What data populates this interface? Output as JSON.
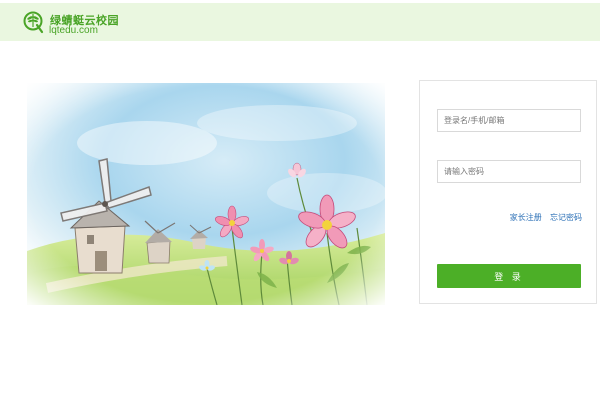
{
  "header": {
    "brand_name": "绿蜻蜓云校园",
    "brand_domain": "lqtedu.com",
    "background_color": "#eaf7e0",
    "brand_color": "#4aa427",
    "logo_icon": "dragonfly-q-logo-icon"
  },
  "illustration": {
    "subject": "windmills-and-cosmos-flowers-watercolor"
  },
  "login": {
    "username_placeholder": "登录名/手机/邮箱",
    "username_value": "",
    "password_placeholder": "请输入密码",
    "password_value": "",
    "parent_register_label": "家长注册",
    "forgot_password_label": "忘记密码",
    "submit_label": "登 录",
    "button_color": "#4caf27",
    "link_color": "#2a6fb6"
  }
}
